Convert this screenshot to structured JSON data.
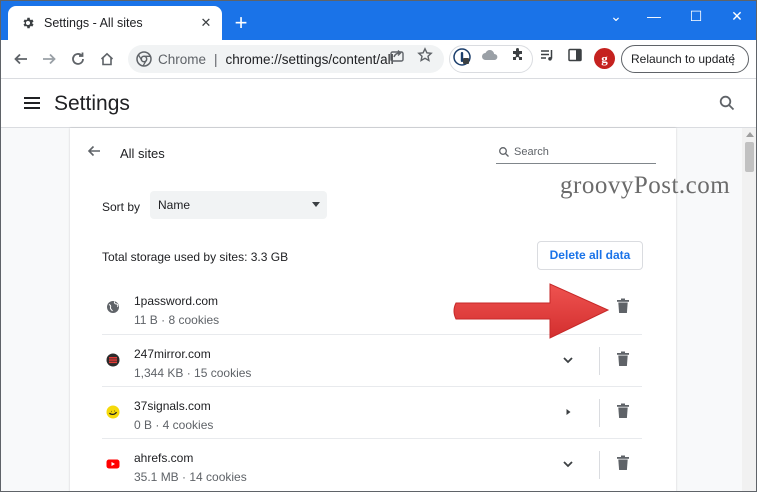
{
  "tab": {
    "title": "Settings - All sites",
    "close_glyph": "✕"
  },
  "window_controls": {
    "minimize": "—",
    "maximize": "☐",
    "close": "✕",
    "chevron": "⌄"
  },
  "newtab_glyph": "+",
  "omnibox": {
    "badge_label": "Chrome",
    "separator": "|",
    "url": "chrome://settings/content/all"
  },
  "profile_initial": "g",
  "relaunch_label": "Relaunch to update",
  "settings_title": "Settings",
  "all_sites": {
    "title": "All sites",
    "search_placeholder": "Search",
    "sort_label": "Sort by",
    "sort_value": "Name",
    "storage_text": "Total storage used by sites: 3.3 GB",
    "delete_all_label": "Delete all data",
    "sites": [
      {
        "name": "1password.com",
        "detail": "11 B · 8 cookies",
        "favicon": "globe-icon",
        "expand": "none"
      },
      {
        "name": "247mirror.com",
        "detail": "1,344 KB · 15 cookies",
        "favicon": "247mirror-favicon",
        "expand": "chevron-down-icon"
      },
      {
        "name": "37signals.com",
        "detail": "0 B · 4 cookies",
        "favicon": "37signals-favicon",
        "expand": "arrow-right-icon"
      },
      {
        "name": "ahrefs.com",
        "detail": "35.1 MB · 14 cookies",
        "favicon": "youtube-favicon",
        "expand": "chevron-down-icon"
      }
    ]
  },
  "watermark": "groovyPost.com",
  "colors": {
    "titlebar": "#1a73e8",
    "accent": "#1a73e8",
    "annotation_arrow": "#e53935"
  }
}
